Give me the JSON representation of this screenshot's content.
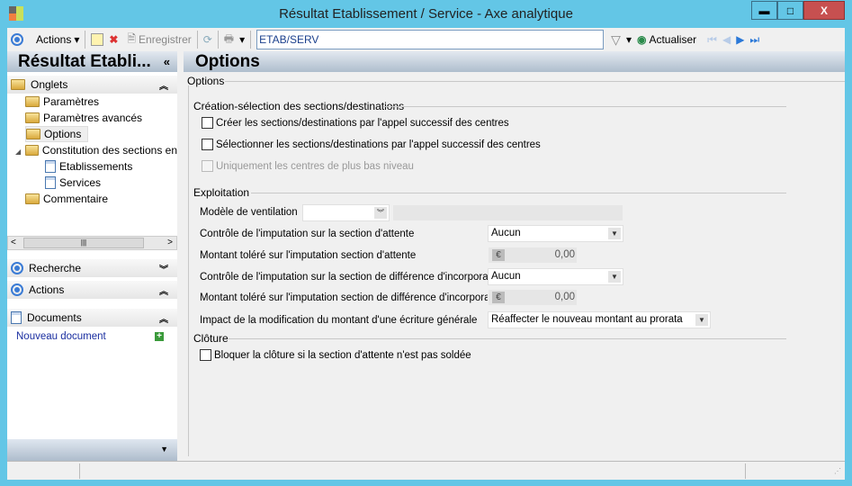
{
  "window": {
    "title": "Résultat Etablissement / Service -  Axe analytique",
    "minimize": "▬",
    "maximize": "□",
    "close": "X"
  },
  "toolbar": {
    "actions": "Actions",
    "save": "Enregistrer",
    "search_value": "ETAB/SERV",
    "refresh": "Actualiser"
  },
  "left": {
    "title": "Résultat Etabli...",
    "collapse": "«",
    "tabs_header": "Onglets",
    "tree": [
      "Paramètres",
      "Paramètres avancés",
      "Options",
      "Constitution des sections en",
      "Etablissements",
      "Services",
      "Commentaire"
    ],
    "search_header": "Recherche",
    "actions_header": "Actions",
    "documents_header": "Documents",
    "new_document": "Nouveau document"
  },
  "main": {
    "title": "Options",
    "group": "Options",
    "creation": {
      "title": "Création-sélection des sections/destinations",
      "options": [
        {
          "label": "Créer les sections/destinations par l'appel successif des centres",
          "checked": false,
          "disabled": false
        },
        {
          "label": "Sélectionner les sections/destinations par l'appel successif des centres",
          "checked": false,
          "disabled": false
        },
        {
          "label": "Uniquement les centres de plus bas niveau",
          "checked": false,
          "disabled": true
        }
      ]
    },
    "exploitation": {
      "title": "Exploitation",
      "model_label": "Modèle de ventilation",
      "model_value": "",
      "control_wait_label": "Contrôle de l'imputation sur la section d'attente",
      "control_wait_value": "Aucun",
      "tol_wait_label": "Montant toléré sur l'imputation section d'attente",
      "tol_wait_value": "0,00",
      "control_diff_label": "Contrôle de l'imputation sur la section de différence d'incorporation",
      "control_diff_value": "Aucun",
      "tol_diff_label": "Montant toléré sur l'imputation section de différence d'incorporation",
      "tol_diff_value": "0,00",
      "impact_label": "Impact de la modification du montant d'une écriture générale",
      "impact_value": "Réaffecter le nouveau montant au prorata",
      "currency": "€"
    },
    "closing": {
      "title": "Clôture",
      "option": "Bloquer la clôture si la section d'attente n'est pas soldée"
    }
  }
}
